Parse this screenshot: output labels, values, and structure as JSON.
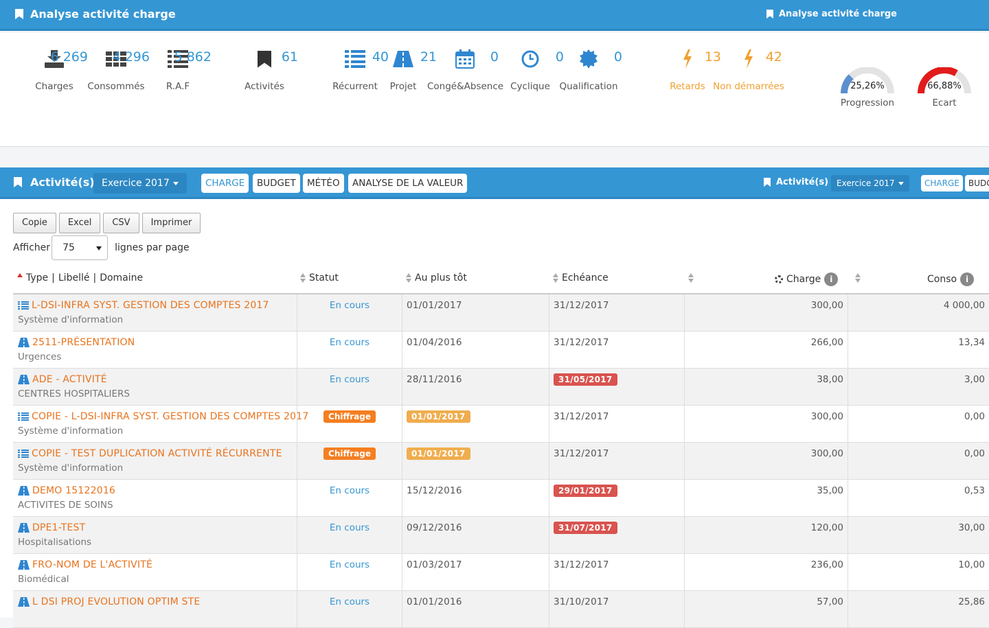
{
  "header": {
    "title": "Analyse activité charge",
    "title_right": "Analyse activité charge"
  },
  "stats": [
    {
      "value": "6 269",
      "label": "Charges",
      "icon": "download-icon"
    },
    {
      "value": "4 296",
      "label": "Consommés",
      "icon": "th-grid-icon"
    },
    {
      "value": "5 862",
      "label": "R.A.F",
      "icon": "list-icon"
    },
    {
      "value": "61",
      "label": "Activités",
      "icon": "bookmark-icon"
    },
    {
      "value": "40",
      "label": "Récurrent",
      "icon": "list-icon"
    },
    {
      "value": "21",
      "label": "Projet",
      "icon": "road-icon"
    },
    {
      "value": "0",
      "label": "Congé&Absence",
      "icon": "calendar-icon"
    },
    {
      "value": "0",
      "label": "Cyclique",
      "icon": "clock-icon"
    },
    {
      "value": "0",
      "label": "Qualification",
      "icon": "certificate-icon"
    },
    {
      "value": "13",
      "label": "Retards",
      "icon": "bolt-icon"
    },
    {
      "value": "42",
      "label": "Non démarrées",
      "icon": "bolt-icon"
    }
  ],
  "gauges": [
    {
      "value": "25,26%",
      "label": "Progression",
      "level": 0.2526,
      "color": "#5b8fd0"
    },
    {
      "value": "66,88%",
      "label": "Ecart",
      "level": 0.6688,
      "color": "#e21b1b"
    }
  ],
  "panel": {
    "title": "Activité(s)",
    "exercise": "Exercice 2017",
    "tabs": [
      "CHARGE",
      "BUDGET",
      "MÉTÉO",
      "ANALYSE DE LA VALEUR"
    ],
    "title_right": "Activité(s)",
    "exercise_right": "Exercice 2017",
    "tab_right_1": "CHARGE",
    "tab_right_2": "BUDG"
  },
  "export_buttons": [
    "Copie",
    "Excel",
    "CSV",
    "Imprimer"
  ],
  "length_control": {
    "prefix": "Afficher",
    "value": "75",
    "suffix": "lignes par page"
  },
  "columns": {
    "type": "Type",
    "libelle": "Libellé",
    "domaine": "Domaine",
    "statut": "Statut",
    "au_plus_tot": "Au plus tôt",
    "echeance": "Echéance",
    "charge": "Charge",
    "conso": "Conso"
  },
  "rows": [
    {
      "icon": "list",
      "title": "L-DSI-INFRA SYST. GESTION DES COMPTES 2017",
      "domain": "Système d'information",
      "statut": "En cours",
      "statut_badge": false,
      "tot": "01/01/2017",
      "tot_badge": false,
      "ech": "31/12/2017",
      "ech_badge": false,
      "charge": "300,00",
      "conso": "4 000,00"
    },
    {
      "icon": "road",
      "title": "2511-PRÉSENTATION",
      "domain": "Urgences",
      "statut": "En cours",
      "statut_badge": false,
      "tot": "01/04/2016",
      "tot_badge": false,
      "ech": "31/12/2017",
      "ech_badge": false,
      "charge": "266,00",
      "conso": "13,34"
    },
    {
      "icon": "road",
      "title": "ADE - ACTIVITÉ",
      "domain": "CENTRES HOSPITALIERS",
      "statut": "En cours",
      "statut_badge": false,
      "tot": "28/11/2016",
      "tot_badge": false,
      "ech": "31/05/2017",
      "ech_badge": true,
      "charge": "38,00",
      "conso": "3,00"
    },
    {
      "icon": "list",
      "title": "COPIE - L-DSI-INFRA SYST. GESTION DES COMPTES 2017",
      "domain": "Système d'information",
      "statut": "Chiffrage",
      "statut_badge": true,
      "tot": "01/01/2017",
      "tot_badge": true,
      "ech": "31/12/2017",
      "ech_badge": false,
      "charge": "300,00",
      "conso": "0,00"
    },
    {
      "icon": "list",
      "title": "COPIE - TEST DUPLICATION ACTIVITÉ RÉCURRENTE",
      "domain": "Système d'information",
      "statut": "Chiffrage",
      "statut_badge": true,
      "tot": "01/01/2017",
      "tot_badge": true,
      "ech": "31/12/2017",
      "ech_badge": false,
      "charge": "300,00",
      "conso": "0,00"
    },
    {
      "icon": "road",
      "title": "DEMO 15122016",
      "domain": "ACTIVITES DE SOINS",
      "statut": "En cours",
      "statut_badge": false,
      "tot": "15/12/2016",
      "tot_badge": false,
      "ech": "29/01/2017",
      "ech_badge": true,
      "charge": "35,00",
      "conso": "0,53"
    },
    {
      "icon": "road",
      "title": "DPE1-TEST",
      "domain": "Hospitalisations",
      "statut": "En cours",
      "statut_badge": false,
      "tot": "09/12/2016",
      "tot_badge": false,
      "ech": "31/07/2017",
      "ech_badge": true,
      "charge": "120,00",
      "conso": "30,00"
    },
    {
      "icon": "road",
      "title": "FRO-NOM DE L'ACTIVITÉ",
      "domain": "Biomédical",
      "statut": "En cours",
      "statut_badge": false,
      "tot": "01/03/2017",
      "tot_badge": false,
      "ech": "31/12/2017",
      "ech_badge": false,
      "charge": "236,00",
      "conso": "10,00"
    },
    {
      "icon": "road",
      "title": "L DSI PROJ EVOLUTION OPTIM STE",
      "domain": "",
      "statut": "En cours",
      "statut_badge": false,
      "tot": "01/01/2016",
      "tot_badge": false,
      "ech": "31/10/2017",
      "ech_badge": false,
      "charge": "57,00",
      "conso": "25,86"
    }
  ],
  "colors": {
    "primary": "#3596d4",
    "accent": "#e8731d",
    "warn": "#f0a030",
    "danger": "#d9534f"
  }
}
